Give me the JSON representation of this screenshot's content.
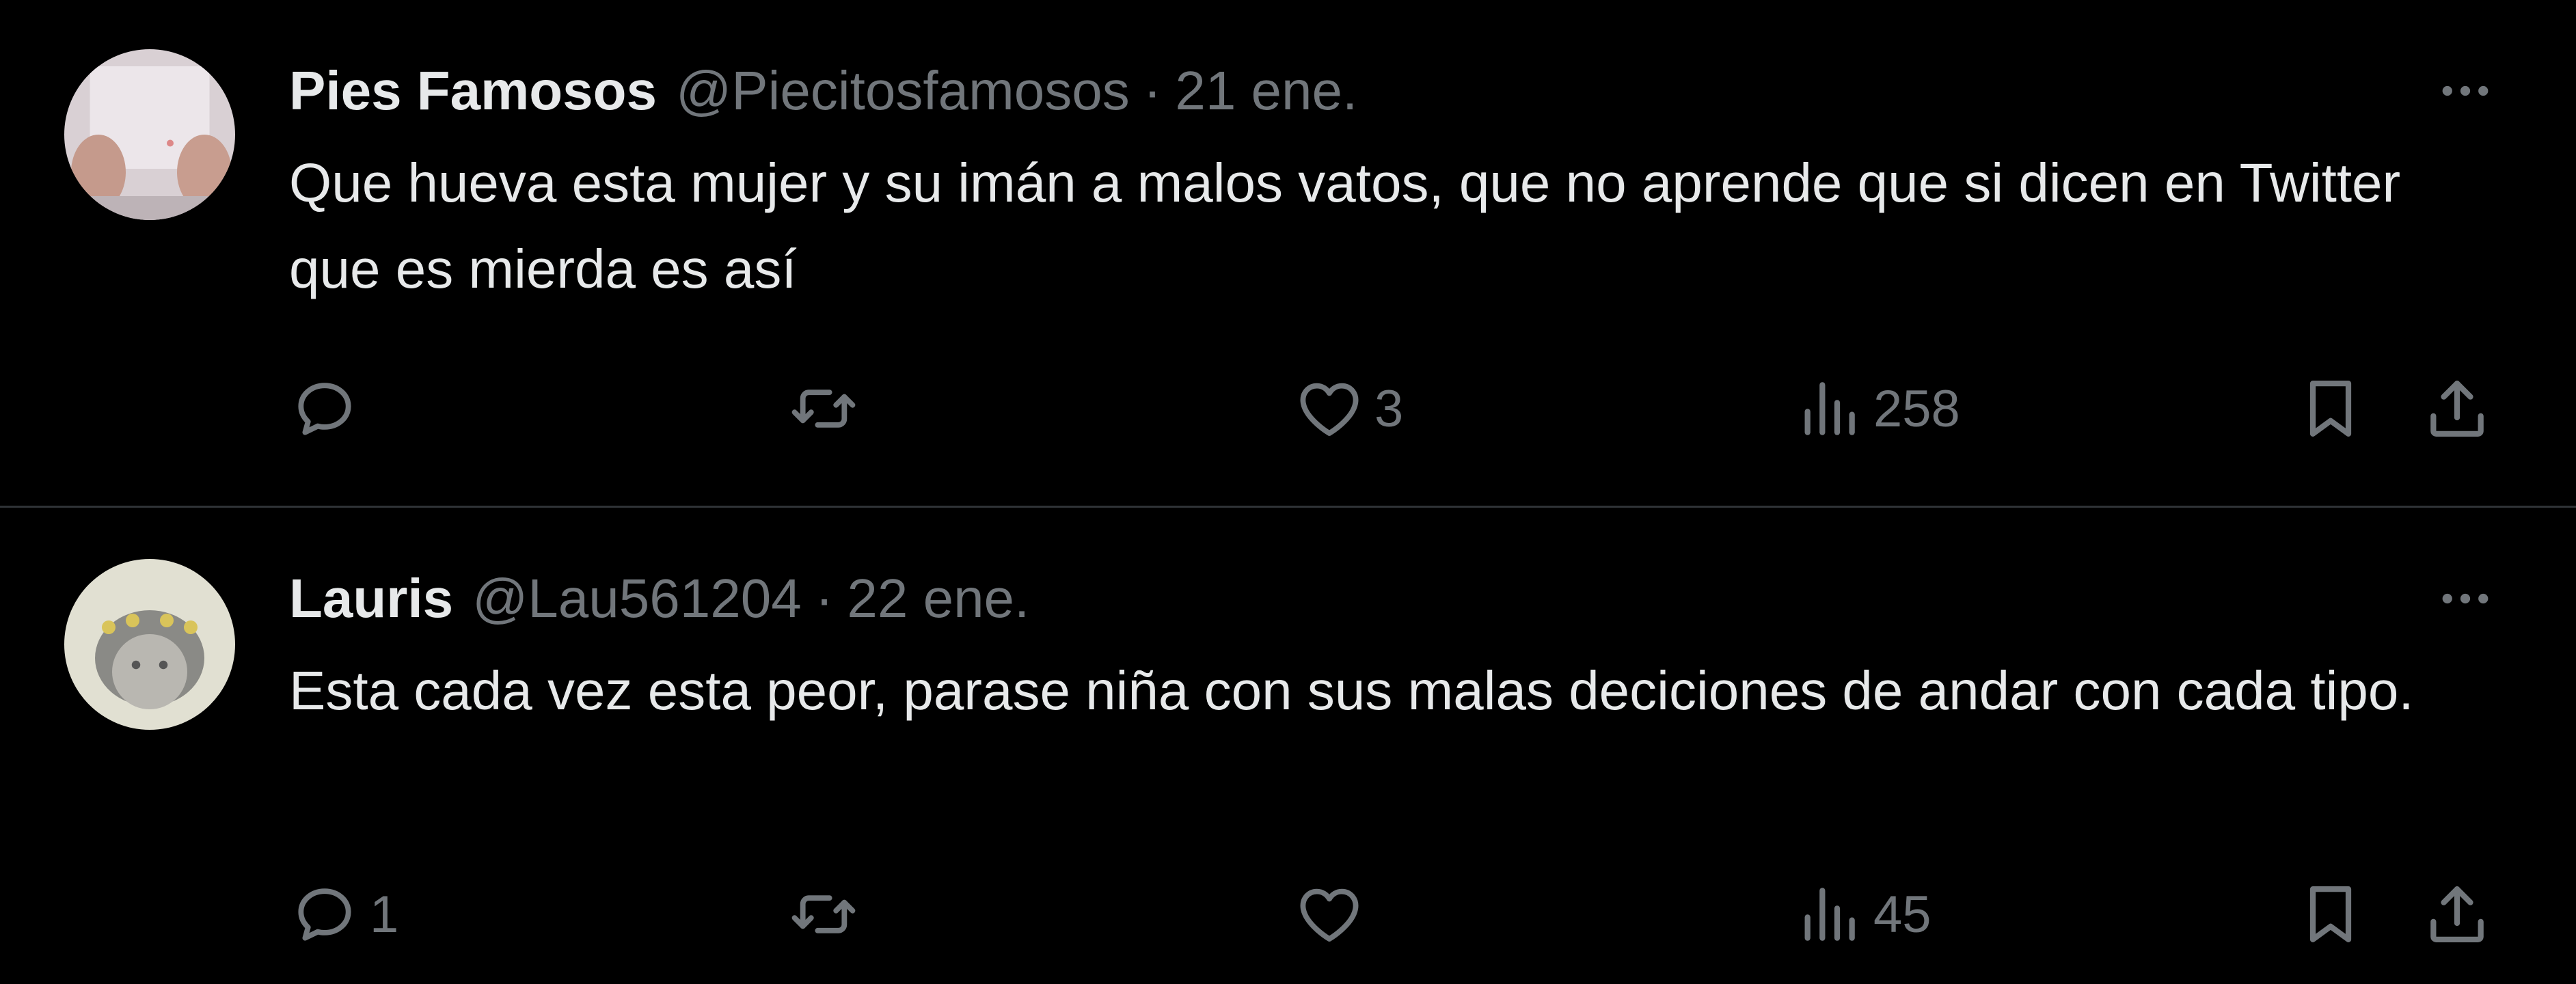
{
  "tweets": [
    {
      "display_name": "Pies Famosos",
      "handle": "@Piecitosfamosos",
      "separator": "·",
      "date": "21 ene.",
      "text": "Que hueva esta mujer y su imán a malos vatos, que no aprende que si dicen en Twitter que es mierda es así",
      "replies": "",
      "retweets": "",
      "likes": "3",
      "views": "258"
    },
    {
      "display_name": "Lauris",
      "handle": "@Lau561204",
      "separator": "·",
      "date": "22 ene.",
      "text": "Esta cada vez esta peor, parase niña con sus malas deciciones de andar con cada tipo.",
      "replies": "1",
      "retweets": "",
      "likes": "",
      "views": "45"
    }
  ],
  "icons": {
    "more": "more-horizontal-icon",
    "reply": "reply-bubble-icon",
    "retweet": "retweet-icon",
    "like": "heart-icon",
    "views": "views-bar-chart-icon",
    "bookmark": "bookmark-icon",
    "share": "share-upload-icon"
  },
  "colors": {
    "background": "#000000",
    "primary_text": "#e7e9ea",
    "secondary_text": "#71767b",
    "divider": "#2f3336"
  }
}
